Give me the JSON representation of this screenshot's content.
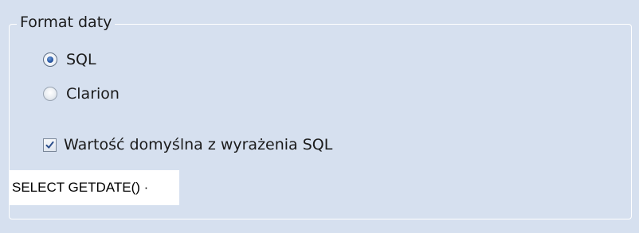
{
  "group": {
    "title": "Format daty"
  },
  "options": {
    "sql_label": "SQL",
    "clarion_label": "Clarion",
    "selected": "SQL"
  },
  "default_value": {
    "label": "Wartość domyślna z wyrażenia SQL",
    "checked": true
  },
  "expression": {
    "value": "SELECT GETDATE() ·"
  }
}
